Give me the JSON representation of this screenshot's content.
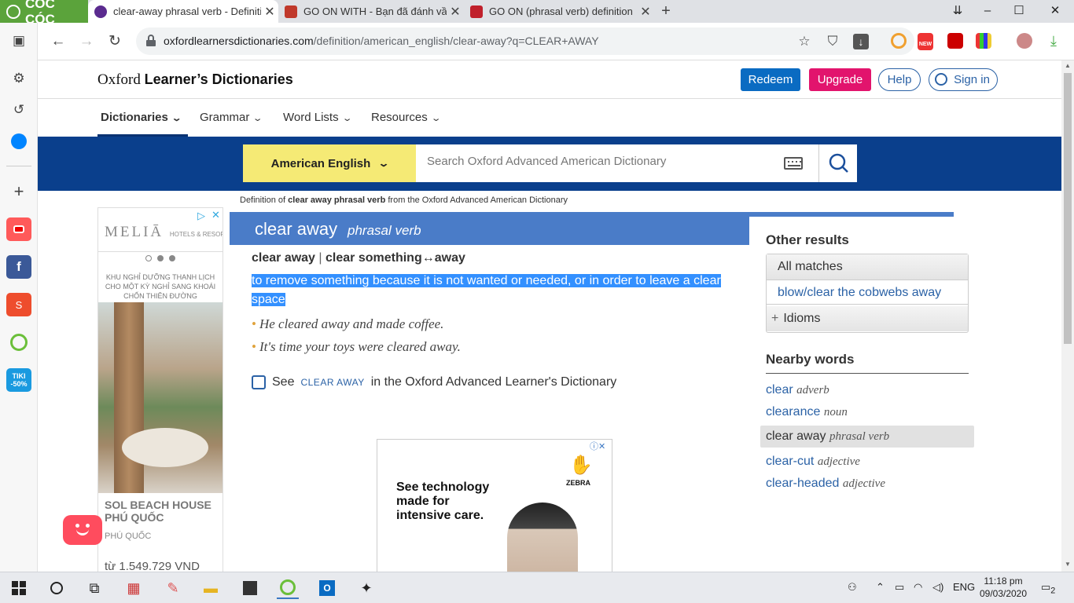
{
  "browser": {
    "brand": "CÓC CÓC",
    "tabs": [
      {
        "title": "clear-away phrasal verb - Definition",
        "fav_color": "#5b2b8f"
      },
      {
        "title": "GO ON WITH - Bạn đã đánh vần",
        "fav_color": "#c0392b"
      },
      {
        "title": "GO ON (phrasal verb) definition",
        "fav_color": "#c0202b"
      }
    ],
    "new_tab": "+",
    "window_controls": [
      "–",
      "☐",
      "✕"
    ],
    "url_host": "oxfordlearnersdictionaries.com",
    "url_path": "/definition/american_english/clear-away?q=CLEAR+AWAY",
    "ext_new_badge": "NEW"
  },
  "sidebar": {
    "promo_label": "TIKI\n-50%"
  },
  "site": {
    "logo_prefix": "Oxford",
    "logo_bold": "Learner’s Dictionaries",
    "buttons": {
      "redeem": "Redeem",
      "upgrade": "Upgrade",
      "help": "Help",
      "signin": "Sign in"
    },
    "nav": [
      "Dictionaries",
      "Grammar",
      "Word Lists",
      "Resources"
    ],
    "dictionary": "American English",
    "search_placeholder": "Search Oxford Advanced American Dictionary",
    "breadcrumb_pre": "Definition of ",
    "breadcrumb_bold": "clear away phrasal verb",
    "breadcrumb_post": " from the Oxford Advanced American Dictionary"
  },
  "entry": {
    "headword": "clear away",
    "pos": "phrasal verb",
    "form1": "clear away",
    "form_sep": "|",
    "form2": "clear something↔away",
    "definition": "to remove something because it is not wanted or needed, or in order to leave a clear space",
    "examples": [
      "He cleared away and made coffee.",
      "It's time your toys were cleared away."
    ],
    "see_pre": "See",
    "see_link": "CLEAR AWAY",
    "see_post": "in the Oxford Advanced Learner's Dictionary"
  },
  "ad_left": {
    "brand": "MELIĀ",
    "brand_sub": "HOTELS & RESORTS",
    "caption": "KHU NGHỈ DƯỠNG THANH LỊCH CHO MỘT KỲ NGHỈ SANG KHOÁI CHỐN THIÊN ĐƯỜNG",
    "title": "SOL BEACH HOUSE PHÚ QUỐC",
    "location": "PHÚ QUỐC",
    "price": "từ 1.549.729 VND"
  },
  "ad_center": {
    "tagline": "See technology made for intensive care.",
    "brand": "ZEBRA",
    "close": "ⓘ✕"
  },
  "right": {
    "other_results": "Other results",
    "all_matches": "All matches",
    "cobwebs": "blow/clear the cobwebs away",
    "idioms": "Idioms",
    "nearby_words": "Nearby words",
    "nearby": [
      {
        "word": "clear",
        "pos": "adverb"
      },
      {
        "word": "clearance",
        "pos": "noun"
      },
      {
        "word": "clear away",
        "pos": "phrasal verb"
      },
      {
        "word": "clear-cut",
        "pos": "adjective"
      },
      {
        "word": "clear-headed",
        "pos": "adjective"
      }
    ]
  },
  "taskbar": {
    "lang": "ENG",
    "time": "11:18 pm",
    "date": "09/03/2020",
    "notifications": "2"
  },
  "colors": {
    "oxford_blue": "#0a3f8c",
    "headword_bar": "#4a7cc8",
    "redeem": "#0a6bc2",
    "upgrade": "#e2146d",
    "dict_yellow": "#f5ea75",
    "selection": "#3390ff"
  }
}
